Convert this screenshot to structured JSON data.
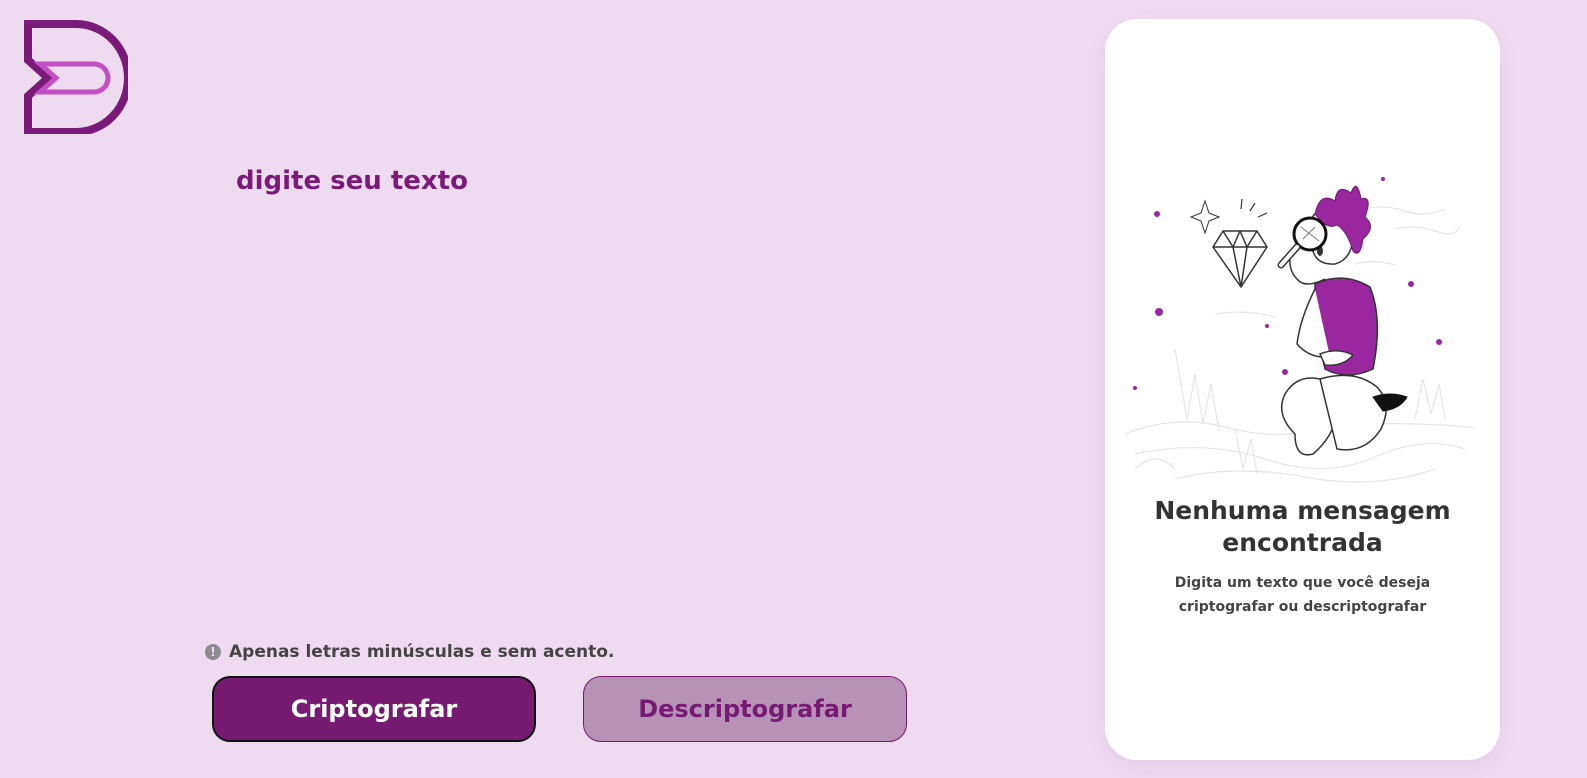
{
  "logo": {
    "icon": "decoder-d-logo-icon"
  },
  "input": {
    "placeholder": "digite seu texto",
    "value": ""
  },
  "hint": {
    "icon": "info-circle-icon",
    "glyph": "!",
    "text": "Apenas letras minúsculas e sem acento."
  },
  "buttons": {
    "encrypt": "Criptografar",
    "decrypt": "Descriptografar"
  },
  "panel": {
    "illustration": "person-with-magnifier-diamond-illustration",
    "title": "Nenhuma mensagem encontrada",
    "description": "Digita um texto que você deseja criptografar ou descriptografar"
  },
  "colors": {
    "background": "#efdbf0",
    "accent": "#771a72",
    "accent_light": "#b792b6",
    "panel": "#ffffff",
    "illustration_purple": "#9b27a0"
  }
}
